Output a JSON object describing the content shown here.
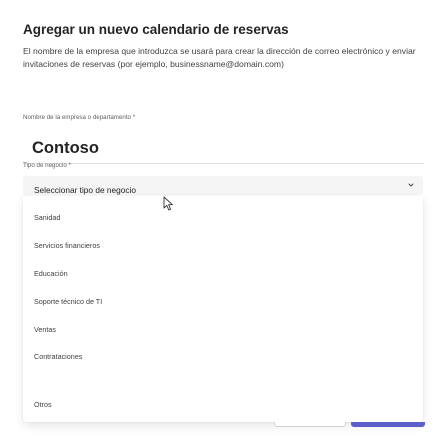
{
  "dialog": {
    "title": "Agregar un nuevo calendario de reservas",
    "description": "El nombre de la empresa que introduzca se usará para crear la dirección de correo electrónico y enviar invitaciones de reservas (por ejemplo, businessname@domain.com)"
  },
  "company_field": {
    "label": "Nombre de la empresa o departamento *",
    "value": "Contoso"
  },
  "business_type": {
    "label": "Tipo de negocio *",
    "placeholder": "Seleccionar tipo de negocio",
    "options": [
      "Sanidad",
      "Servicios financieros",
      "Educación",
      "Soporte técnico de TI",
      "Ventas",
      "Contrataciones",
      "Otros"
    ]
  },
  "colors": {
    "accent": "#5b5fc7",
    "field_background": "#f5f5f5"
  },
  "icons": {
    "dropdown": "chevron-down-icon",
    "pointer": "mouse-cursor-icon"
  }
}
